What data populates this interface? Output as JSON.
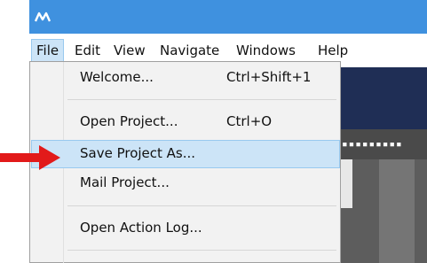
{
  "menubar": {
    "items": [
      {
        "label": "File"
      },
      {
        "label": "Edit"
      },
      {
        "label": "View"
      },
      {
        "label": "Navigate"
      },
      {
        "label": "Windows"
      },
      {
        "label": "Help"
      }
    ]
  },
  "file_menu": {
    "items": [
      {
        "label": "Welcome...",
        "shortcut": "Ctrl+Shift+1"
      },
      {
        "label": "Open Project...",
        "shortcut": "Ctrl+O"
      },
      {
        "label": "Save Project As...",
        "shortcut": ""
      },
      {
        "label": "Mail Project...",
        "shortcut": ""
      },
      {
        "label": "Open Action Log...",
        "shortcut": ""
      }
    ],
    "highlighted": "Save Project As..."
  },
  "colors": {
    "titlebar": "#3f91df",
    "highlight": "#cce4f7",
    "arrow": "#e21a1a"
  },
  "icons": {
    "app_logo": "app-logo-icon",
    "pointer": "red-arrow-icon"
  }
}
